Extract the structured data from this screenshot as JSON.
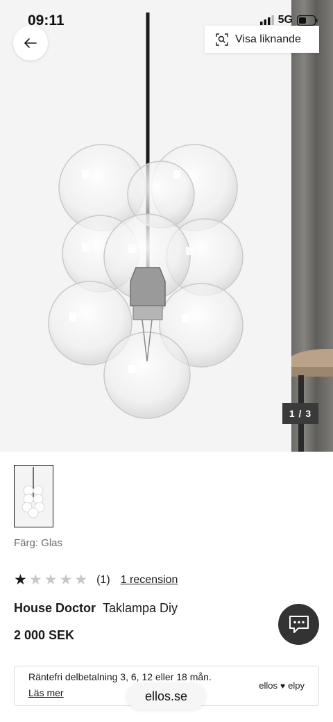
{
  "status_bar": {
    "time": "09:11",
    "network": "5G"
  },
  "gallery": {
    "similar_label": "Visa liknande",
    "counter": "1 / 3"
  },
  "product": {
    "color_label": "Färg: Glas",
    "rating_value": 1,
    "rating_max": 5,
    "review_count": "(1)",
    "review_link": "1 recension",
    "brand": "House Doctor",
    "name": "Taklampa Diy",
    "price": "2 000 SEK"
  },
  "finance": {
    "text": "Räntefri delbetalning 3, 6, 12 eller 18 mån.",
    "link": "Läs mer",
    "logo_left": "ellos",
    "logo_right": "elpy"
  },
  "browser": {
    "url": "ellos.se"
  },
  "icons": {
    "back": "arrow-left-icon",
    "similar": "visual-search-icon",
    "chat": "chat-bubble-icon",
    "heart": "heart-icon"
  },
  "colors": {
    "star_filled": "#1a1a1a",
    "star_empty": "#c8c8c8",
    "counter_bg": "#3a3a3a",
    "chat_bg": "#333333"
  }
}
